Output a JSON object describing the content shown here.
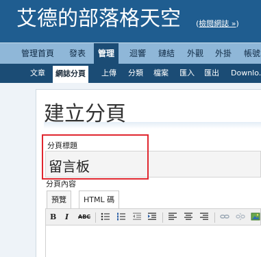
{
  "header": {
    "site_title": "艾德的部落格天空",
    "view_blog": "檢閱網誌 »"
  },
  "main_nav": {
    "items": [
      {
        "label": "管理首頁",
        "active": false
      },
      {
        "label": "發表",
        "active": false
      },
      {
        "label": "管理",
        "active": true
      },
      {
        "label": "迴響",
        "active": false
      },
      {
        "label": "鏈結",
        "active": false
      },
      {
        "label": "外觀",
        "active": false
      },
      {
        "label": "外掛",
        "active": false
      },
      {
        "label": "帳號",
        "active": false
      }
    ]
  },
  "sub_nav": {
    "items": [
      {
        "label": "文章",
        "active": false
      },
      {
        "label": "網誌分頁",
        "active": true
      },
      {
        "label": "上傳",
        "active": false
      },
      {
        "label": "分類",
        "active": false
      },
      {
        "label": "檔案",
        "active": false
      },
      {
        "label": "匯入",
        "active": false
      },
      {
        "label": "匯出",
        "active": false
      },
      {
        "label": "Downlo...",
        "active": false
      }
    ]
  },
  "page": {
    "heading": "建立分頁",
    "title_label": "分頁標題",
    "title_value": "留言板",
    "content_label": "分頁內容"
  },
  "editor": {
    "tabs": [
      {
        "label": "預覽",
        "active": true
      },
      {
        "label": "HTML 碼",
        "active": false
      }
    ],
    "toolbar": {
      "bold": "B",
      "italic": "I",
      "strike": "ABC",
      "icons": [
        "bold-icon",
        "italic-icon",
        "strikethrough-icon",
        "bullet-list-icon",
        "numbered-list-icon",
        "outdent-icon",
        "indent-icon",
        "align-left-icon",
        "align-center-icon",
        "align-right-icon",
        "link-icon",
        "unlink-icon",
        "image-icon"
      ]
    }
  },
  "colors": {
    "header_bg": "#1f5d90",
    "nav_bg": "#8fb7d8",
    "subnav_bg": "#1b4c75",
    "highlight": "#e0262e"
  }
}
